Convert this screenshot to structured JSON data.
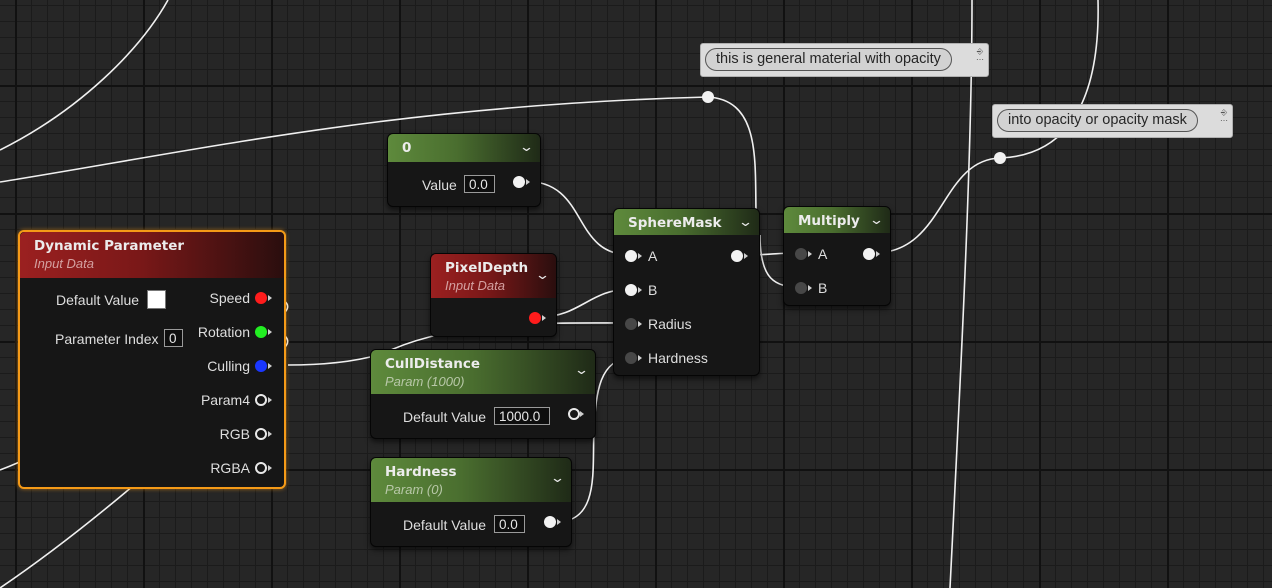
{
  "colors": {
    "wire": "#ffffff",
    "selection": "#f59a17",
    "param_header": "#5e8a3c",
    "input_data_header": "#9b2020",
    "pin_speed": "#ff1c1c",
    "pin_rotation": "#22ee22",
    "pin_culling": "#1a37ff"
  },
  "comments": [
    {
      "text": "this is general material with opacity"
    },
    {
      "text": "into opacity or opacity mask"
    }
  ],
  "nodes": {
    "constant": {
      "title": "0",
      "value_label": "Value",
      "value": "0.0"
    },
    "dynamic_parameter": {
      "title": "Dynamic Parameter",
      "subtitle": "Input Data",
      "default_value_label": "Default Value",
      "parameter_index_label": "Parameter Index",
      "parameter_index": "0",
      "outputs": [
        "Speed",
        "Rotation",
        "Culling",
        "Param4",
        "RGB",
        "RGBA"
      ]
    },
    "pixel_depth": {
      "title": "PixelDepth",
      "subtitle": "Input Data"
    },
    "cull_distance": {
      "title": "CullDistance",
      "subtitle": "Param (1000)",
      "default_value_label": "Default Value",
      "default_value": "1000.0"
    },
    "hardness": {
      "title": "Hardness",
      "subtitle": "Param (0)",
      "default_value_label": "Default Value",
      "default_value": "0.0"
    },
    "sphere_mask": {
      "title": "SphereMask",
      "inputs": [
        "A",
        "B",
        "Radius",
        "Hardness"
      ]
    },
    "multiply": {
      "title": "Multiply",
      "inputs": [
        "A",
        "B"
      ]
    }
  },
  "icons": {
    "dropdown": "chevron-down-icon",
    "comment_pin": "pin-icon"
  }
}
